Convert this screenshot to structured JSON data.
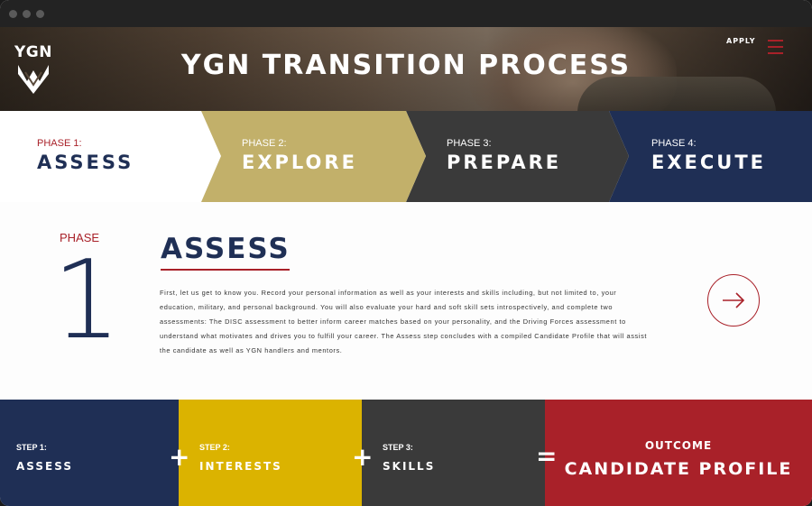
{
  "colors": {
    "navy": "#1f2f55",
    "gold": "#c2b06a",
    "dark_gray": "#3a3a3a",
    "red": "#a92129",
    "yellow": "#dbb300"
  },
  "header": {
    "logo_text": "YGN",
    "title": "YGN TRANSITION PROCESS",
    "apply_label": "APPLY",
    "menu_icon": "hamburger-menu-icon"
  },
  "phases": [
    {
      "label": "PHASE 1:",
      "name": "ASSESS"
    },
    {
      "label": "PHASE 2:",
      "name": "EXPLORE"
    },
    {
      "label": "PHASE 3:",
      "name": "PREPARE"
    },
    {
      "label": "PHASE 4:",
      "name": "EXECUTE"
    }
  ],
  "detail": {
    "phase_word": "PHASE",
    "phase_number": "1",
    "title": "ASSESS",
    "description": "First, let us get to know you. Record your personal information as well as your interests and skills including, but not limited to, your education, military, and personal background. You will also evaluate your hard and soft skill sets introspectively, and complete two assessments: The DISC assessment to better inform career matches based on your personality, and the Driving Forces assessment to understand what motivates and drives you to fulfill your career. The Assess step concludes with a compiled Candidate Profile that will assist the candidate as well as YGN handlers and mentors.",
    "next_icon": "arrow-right-icon"
  },
  "steps": [
    {
      "label": "STEP 1:",
      "name": "ASSESS"
    },
    {
      "label": "STEP 2:",
      "name": "INTERESTS"
    },
    {
      "label": "STEP 3:",
      "name": "SKILLS"
    }
  ],
  "operators": {
    "plus": "+",
    "equals": "="
  },
  "outcome": {
    "label": "OUTCOME",
    "name": "CANDIDATE PROFILE"
  }
}
